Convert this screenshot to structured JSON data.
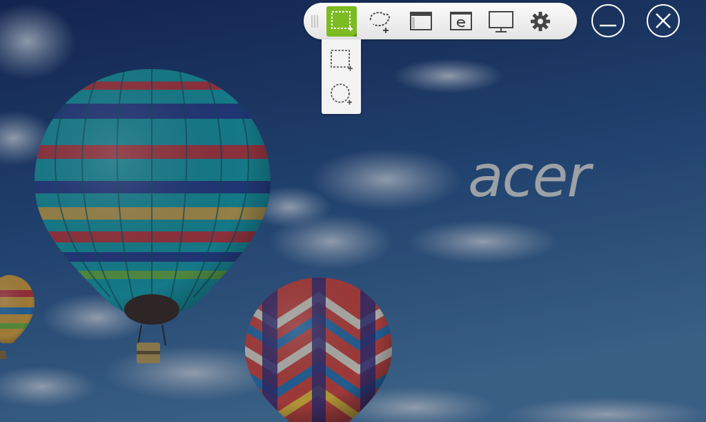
{
  "brand": {
    "wordmark": "acer"
  },
  "toolbar": {
    "buttons": [
      {
        "id": "rectangle-capture",
        "icon": "dashed-rectangle-plus-icon",
        "active": true
      },
      {
        "id": "freeform-capture",
        "icon": "dashed-lasso-plus-icon",
        "active": false
      },
      {
        "id": "window-capture",
        "icon": "window-icon",
        "active": false
      },
      {
        "id": "webpage-capture",
        "icon": "web-page-e-icon",
        "active": false
      },
      {
        "id": "fullscreen-capture",
        "icon": "monitor-icon",
        "active": false
      },
      {
        "id": "settings",
        "icon": "gear-icon",
        "active": false
      }
    ],
    "accent_color": "#7dbb22"
  },
  "dropdown": {
    "items": [
      {
        "id": "rectangle-selection",
        "icon": "dashed-rectangle-plus-icon"
      },
      {
        "id": "circle-selection",
        "icon": "dashed-circle-plus-icon"
      }
    ]
  },
  "window_controls": {
    "minimize": {
      "icon": "minimize-icon"
    },
    "close": {
      "icon": "close-icon"
    }
  },
  "colors": {
    "sky_top": "#17305f",
    "sky_bottom": "#3f6c96",
    "overlay_tint": "#0b1a33"
  }
}
